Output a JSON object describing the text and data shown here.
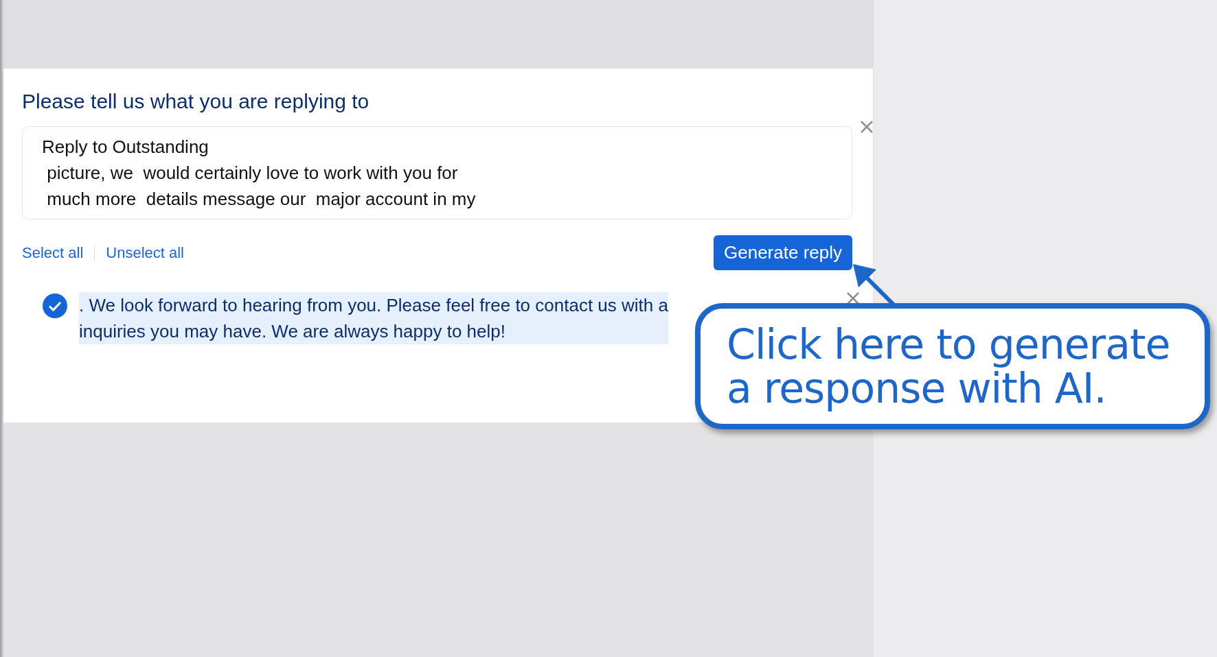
{
  "dialog": {
    "title": "Please tell us what you are replying to",
    "context_field": {
      "lines": [
        "Reply to Outstanding",
        " picture, we  would certainly love to work with you for",
        " much more  details message our  major account in my"
      ]
    },
    "links": [
      {
        "label": "Select all"
      },
      {
        "label": "Unselect all"
      }
    ],
    "generate_button": "Generate reply",
    "suggestions": [
      {
        "selected": true,
        "lines": [
          ". We look forward to hearing from you. Please feel free to contact us with a",
          "inquiries you may have. We are always happy to help!"
        ]
      }
    ]
  },
  "callout": {
    "lines": [
      "Click here to generate",
      "a response with AI."
    ]
  }
}
